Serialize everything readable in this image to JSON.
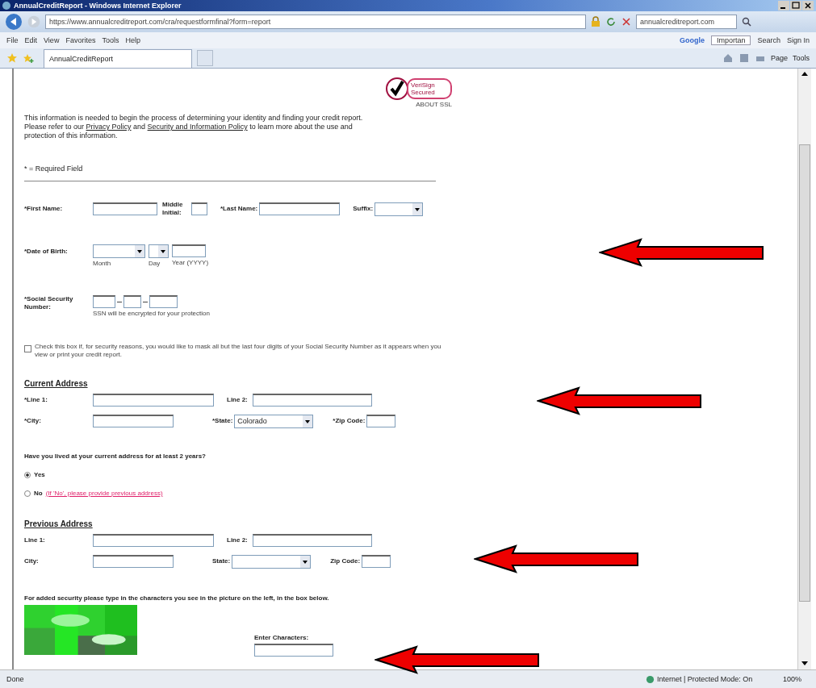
{
  "window": {
    "title": "AnnualCreditReport - Windows Internet Explorer"
  },
  "address_bar": {
    "url": "https://www.annualcreditreport.com/cra/requestformfinal?form=report",
    "search_value": "annualcreditreport.com"
  },
  "menu": [
    "File",
    "Edit",
    "View",
    "Favorites",
    "Tools",
    "Help"
  ],
  "google_toolbar": {
    "logo": "Google",
    "dropdown": "Importan",
    "search": "Search",
    "sign_in": "Sign In"
  },
  "tab": {
    "label": "AnnualCreditReport"
  },
  "command_bar": [
    "Page",
    "Tools"
  ],
  "form": {
    "intro": {
      "before": "This information is needed to begin the process of determining your identity and finding your credit report. Please refer to our",
      "link_1": "Privacy Policy",
      "middle": "and",
      "link_2": "Security and Information Policy",
      "after": "to learn more about the use and protection of this information."
    },
    "seal": {
      "label": "VeriSign Secured",
      "caption": "ABOUT SSL"
    },
    "required_note": "* = Required Field",
    "name": {
      "first": "*First Name:",
      "middle": "Middle Initial:",
      "last": "*Last Name:",
      "suffix": "Suffix:"
    },
    "birth": {
      "label": "*Date of Birth:",
      "month": "Month",
      "day": "Day",
      "year": "Year (YYYY)"
    },
    "ssn": {
      "label": "*Social Security Number:",
      "note": "SSN will be encrypted for your protection"
    },
    "mask": {
      "checked": false,
      "label": "Check this box if, for security reasons, you would like to mask all but the last four digits of your Social Security Number as it appears when you view or print your credit report."
    },
    "current": {
      "heading": "Current Address",
      "line1": "*Line 1:",
      "line2": "Line 2:",
      "city": "*City:",
      "state": "*State:",
      "state_value": "Colorado",
      "zip": "*Zip Code:"
    },
    "question": "Have you lived at your current address for at least 2 years?",
    "answers": [
      {
        "label": "Yes",
        "selected": true
      },
      {
        "label": "No",
        "note": "(If 'No', please provide previous address)",
        "selected": false
      }
    ],
    "previous": {
      "heading": "Previous Address",
      "line1": "Line 1:",
      "line2": "Line 2:",
      "city": "City:",
      "state": "State:",
      "zip": "Zip Code:"
    },
    "captcha": {
      "instructions": "For added security please type in the characters you see in the picture on the left, in the box below.",
      "input_label": "Enter Characters:"
    }
  },
  "status_bar": {
    "text": "Done",
    "zone": "Internet | Protected Mode: On",
    "zoom": "100%"
  }
}
